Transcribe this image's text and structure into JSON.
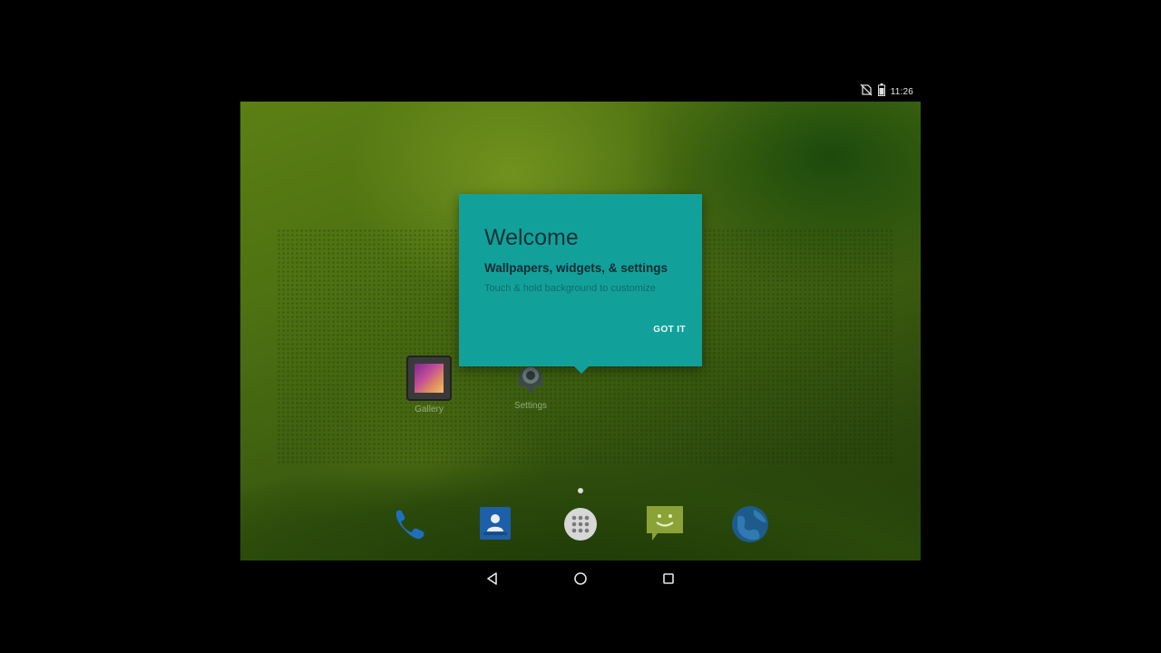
{
  "status_bar": {
    "time": "11:26",
    "icons": [
      "no-sim-icon",
      "battery-icon"
    ]
  },
  "home": {
    "apps": [
      {
        "label": "Gallery",
        "icon": "gallery-icon"
      },
      {
        "label": "Settings",
        "icon": "settings-icon"
      }
    ],
    "dock": [
      {
        "icon": "phone-icon"
      },
      {
        "icon": "contacts-icon"
      },
      {
        "icon": "app-drawer-icon"
      },
      {
        "icon": "messaging-icon"
      },
      {
        "icon": "browser-icon"
      }
    ]
  },
  "welcome_tip": {
    "title": "Welcome",
    "heading": "Wallpapers, widgets, & settings",
    "body": "Touch & hold background to customize",
    "button": "GOT IT",
    "background_color": "#12a19a"
  },
  "nav_bar": {
    "buttons": [
      "back-icon",
      "home-icon",
      "recents-icon"
    ]
  }
}
